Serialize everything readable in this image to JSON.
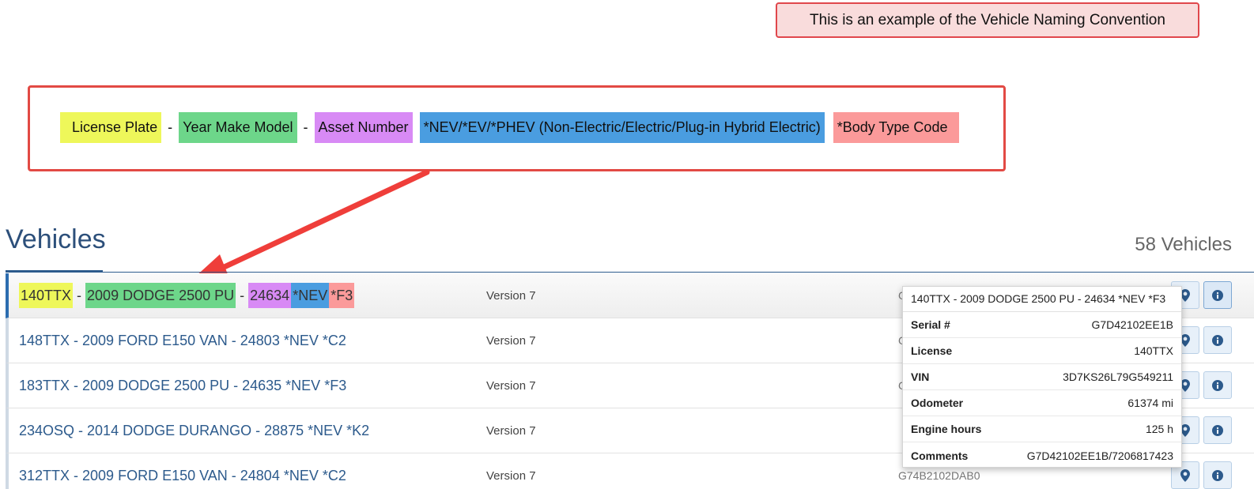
{
  "callout": {
    "text": "This is an example of the Vehicle Naming Convention"
  },
  "legend": {
    "license_plate": "License Plate",
    "year_make_model": "Year Make Model",
    "asset_number": "Asset Number",
    "power_type": "*NEV/*EV/*PHEV (Non-Electric/Electric/Plug-in Hybrid Electric)",
    "body_type": "*Body Type Code",
    "separator": "-",
    "colors": {
      "license_plate": "#eef75a",
      "year_make_model": "#6dd68a",
      "asset_number": "#d88af5",
      "power_type": "#4a9de0",
      "body_type": "#fb9a9a"
    }
  },
  "header": {
    "title": "Vehicles",
    "count": "58 Vehicles"
  },
  "vehicles": [
    {
      "plate": "140TTX",
      "ymm": "2009 DODGE 2500 PU",
      "asset": "24634",
      "power": "*NEV",
      "body": "*F3",
      "version": "Version 7",
      "serial": "G7D42102EE1B"
    },
    {
      "name": "148TTX - 2009 FORD E150 VAN - 24803 *NEV *C2",
      "version": "Version 7",
      "serial": "G"
    },
    {
      "name": "183TTX - 2009 DODGE 2500 PU - 24635 *NEV *F3",
      "version": "Version 7",
      "serial": "G"
    },
    {
      "name": "234OSQ - 2014 DODGE DURANGO - 28875 *NEV *K2",
      "version": "Version 7",
      "serial": ""
    },
    {
      "name": "312TTX - 2009 FORD E150 VAN - 24804 *NEV *C2",
      "version": "Version 7",
      "serial": "G74B2102DAB0"
    }
  ],
  "popup": {
    "title": "140TTX - 2009 DODGE 2500 PU - 24634 *NEV *F3",
    "rows": [
      {
        "key": "Serial #",
        "value": "G7D42102EE1B"
      },
      {
        "key": "License",
        "value": "140TTX"
      },
      {
        "key": "VIN",
        "value": "3D7KS26L79G549211"
      },
      {
        "key": "Odometer",
        "value": "61374 mi"
      },
      {
        "key": "Engine hours",
        "value": "125 h"
      },
      {
        "key": "Comments",
        "value": "G7D42102EE1B/7206817423"
      }
    ]
  },
  "icons": {
    "map_button": "map-marker-icon",
    "info_button": "info-icon"
  },
  "accent_color": "#2c5a8c"
}
